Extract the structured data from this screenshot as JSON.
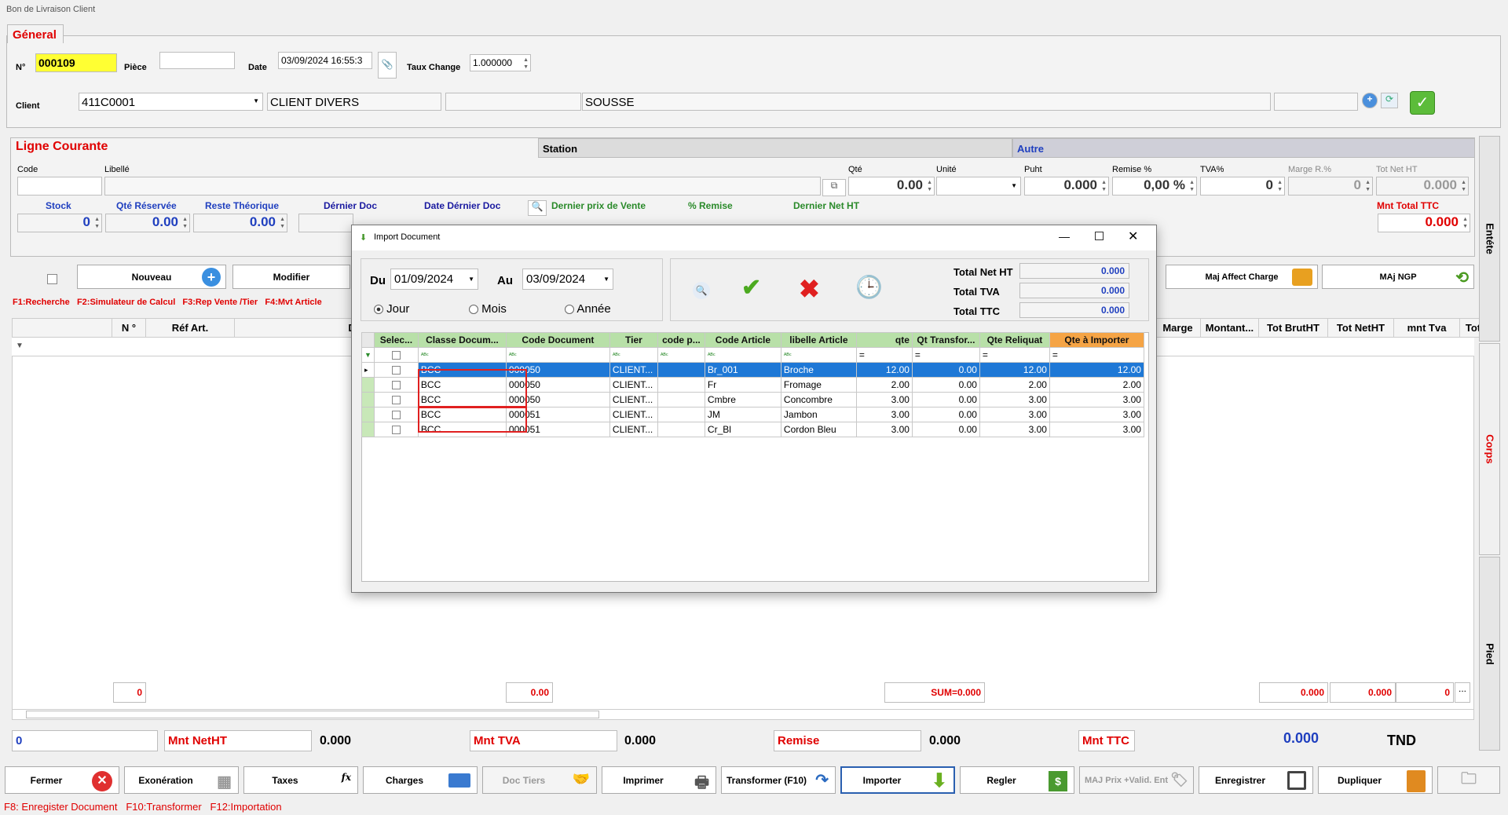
{
  "window": {
    "title": "Bon de Livraison Client"
  },
  "general": {
    "tab": "Géneral",
    "no_label": "N°",
    "no_value": "000109",
    "piece_label": "Pièce",
    "piece_value": "",
    "date_label": "Date",
    "date_value": "03/09/2024 16:55:3",
    "taux_label": "Taux Change",
    "taux_value": "1.000000",
    "client_label": "Client",
    "client_code": "411C0001",
    "client_name": "CLIENT DIVERS",
    "client_city": "SOUSSE"
  },
  "ligne": {
    "title": "Ligne Courante",
    "station": "Station",
    "autre": "Autre",
    "code_label": "Code",
    "libelle_label": "Libellé",
    "qte_label": "Qté",
    "qte_value": "0.00",
    "unite_label": "Unité",
    "puht_label": "Puht",
    "puht_value": "0.000",
    "remise_label": "Remise %",
    "remise_value": "0,00 %",
    "tva_label": "TVA%",
    "tva_value": "0",
    "marge_label": "Marge R.%",
    "marge_value": "0",
    "totnet_label": "Tot Net HT",
    "totnet_value": "0.000",
    "stock_label": "Stock",
    "stock_value": "0",
    "qte_res_label": "Qté Réservée",
    "qte_res_value": "0.00",
    "reste_label": "Reste Théorique",
    "reste_value": "0.00",
    "dernier_doc_label": "Dérnier Doc",
    "date_dernier_label": "Date Dérnier Doc",
    "dernier_prix_label": "Dernier prix de Vente",
    "pct_remise_label": "% Remise",
    "dernier_net_label": "Dernier Net HT",
    "mnt_total_label": "Mnt Total  TTC",
    "mnt_total_value": "0.000"
  },
  "toolbar": {
    "nouveau": "Nouveau",
    "modifier": "Modifier",
    "maj_affect": "Maj Affect Charge",
    "maj_ngp": "MAj NGP"
  },
  "shortcuts": {
    "f1": "F1:Recherche",
    "f2": "F2:Simulateur de Calcul",
    "f3": "F3:Rep Vente /Tier",
    "f4": "F4:Mvt Article"
  },
  "grid": {
    "col_no": "N °",
    "col_ref": "Réf Art.",
    "col_de": "De",
    "col_marge": "Marge",
    "col_montant": "Montant...",
    "col_totbrut": "Tot BrutHT",
    "col_totnet": "Tot NetHT",
    "col_mnttva": "mnt Tva",
    "col_tot": "Tot"
  },
  "footer_sums": {
    "s1": "0",
    "s2": "0.00",
    "s3": "SUM=0.000",
    "s4": "0.000",
    "s5": "0.000",
    "s6": "0"
  },
  "totals": {
    "first": "0",
    "mnt_net_label": "Mnt NetHT",
    "mnt_net": "0.000",
    "mnt_tva_label": "Mnt TVA",
    "mnt_tva": "0.000",
    "remise_label": "Remise",
    "remise": "0.000",
    "mnt_ttc_label": "Mnt TTC",
    "mnt_ttc": "0.000",
    "devise": "TND"
  },
  "side_tabs": {
    "entete": "Entéte",
    "corps": "Corps",
    "pied": "Pied"
  },
  "bottom_buttons": [
    "Fermer",
    "Exonération",
    "Taxes",
    "Charges",
    "Doc Tiers",
    "Imprimer",
    "Transformer (F10)",
    "Importer",
    "Regler",
    "MAJ Prix +Valid. Ent",
    "Enregistrer",
    "Dupliquer"
  ],
  "status": {
    "f8": "F8: Enregister Document",
    "f10": "F10:Transformer",
    "f12": "F12:Importation"
  },
  "dialog": {
    "title": "Import Document",
    "du_label": "Du",
    "du_value": "01/09/2024",
    "au_label": "Au",
    "au_value": "03/09/2024",
    "jour": "Jour",
    "mois": "Mois",
    "annee": "Année",
    "total_net_label": "Total Net HT",
    "total_net": "0.000",
    "total_tva_label": "Total TVA",
    "total_tva": "0.000",
    "total_ttc_label": "Total TTC",
    "total_ttc": "0.000",
    "columns": [
      "Selec...",
      "Classe Docum...",
      "Code Document",
      "Tier",
      "code p...",
      "Code Article",
      "libelle Article",
      "qte",
      "Qt Transfor...",
      "Qte Reliquat",
      "Qte à Importer"
    ],
    "rows": [
      {
        "classe": "BCC",
        "code": "000050",
        "tier": "CLIENT...",
        "codep": "",
        "article": "Br_001",
        "libelle": "Broche",
        "qte": "12.00",
        "transf": "0.00",
        "reliquat": "12.00",
        "importer": "12.00"
      },
      {
        "classe": "BCC",
        "code": "000050",
        "tier": "CLIENT...",
        "codep": "",
        "article": "Fr",
        "libelle": "Fromage",
        "qte": "2.00",
        "transf": "0.00",
        "reliquat": "2.00",
        "importer": "2.00"
      },
      {
        "classe": "BCC",
        "code": "000050",
        "tier": "CLIENT...",
        "codep": "",
        "article": "Cmbre",
        "libelle": "Concombre",
        "qte": "3.00",
        "transf": "0.00",
        "reliquat": "3.00",
        "importer": "3.00"
      },
      {
        "classe": "BCC",
        "code": "000051",
        "tier": "CLIENT...",
        "codep": "",
        "article": "JM",
        "libelle": "Jambon",
        "qte": "3.00",
        "transf": "0.00",
        "reliquat": "3.00",
        "importer": "3.00"
      },
      {
        "classe": "BCC",
        "code": "000051",
        "tier": "CLIENT...",
        "codep": "",
        "article": "Cr_Bl",
        "libelle": "Cordon Bleu",
        "qte": "3.00",
        "transf": "0.00",
        "reliquat": "3.00",
        "importer": "3.00"
      }
    ]
  }
}
